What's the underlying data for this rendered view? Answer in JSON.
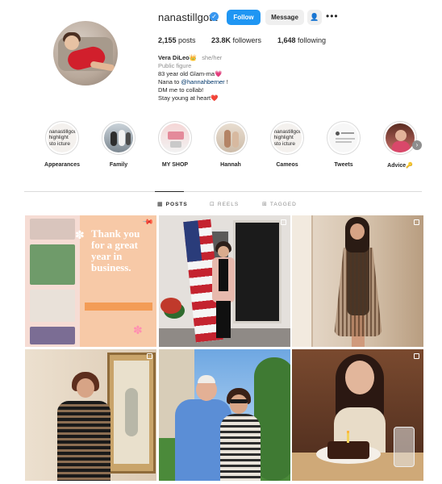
{
  "profile": {
    "username": "nanastillgotit",
    "follow_label": "Follow",
    "message_label": "Message",
    "add_user_icon": "person-add-icon",
    "more_icon": "more-icon"
  },
  "stats": {
    "posts": "2,155",
    "posts_label": "posts",
    "followers": "23.8K",
    "followers_label": "followers",
    "following": "1,648",
    "following_label": "following"
  },
  "bio": {
    "name": "Vera DiLeo",
    "name_emoji": "👑",
    "pronouns": "she/her",
    "category": "Public figure",
    "line1": "83 year old Glam-ma💗",
    "line2_prefix": "Nana to ",
    "mention": "@hannahberner",
    "line2_suffix": " !",
    "line3": "DM me to collab!",
    "line4": "Stay young at heart❤️"
  },
  "highlights": [
    {
      "label": "Appearances",
      "placeholder": "nanastillgot highlight sto icture"
    },
    {
      "label": "Family"
    },
    {
      "label": "MY SHOP"
    },
    {
      "label": "Hannah"
    },
    {
      "label": "Cameos",
      "placeholder": "nanastillgot highlight sto icture"
    },
    {
      "label": "Tweets"
    },
    {
      "label": "Advice🔑"
    }
  ],
  "tabs": [
    {
      "label": "POSTS",
      "icon": "grid-icon",
      "active": true
    },
    {
      "label": "REELS",
      "icon": "reels-icon",
      "active": false
    },
    {
      "label": "TAGGED",
      "icon": "tagged-icon",
      "active": false
    }
  ],
  "posts": [
    {
      "caption_1": "Thank you",
      "caption_2": "for a great",
      "caption_3": "year in",
      "caption_4": "business."
    }
  ],
  "colors": {
    "accent": "#1f96f3",
    "verified": "#3897f0",
    "mention": "#00376b"
  }
}
